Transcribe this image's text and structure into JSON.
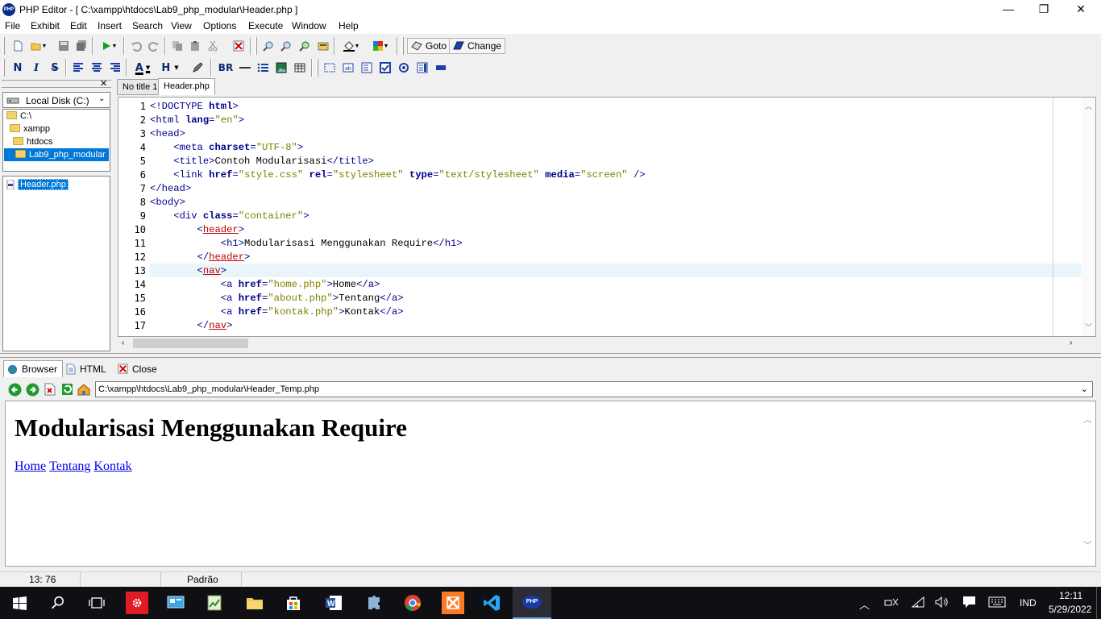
{
  "window": {
    "app_icon": "PHP",
    "title": "PHP Editor - [ C:\\xampp\\htdocs\\Lab9_php_modular\\Header.php ]",
    "minimize": "—",
    "maximize": "❐",
    "close": "✕"
  },
  "menu": [
    "File",
    "Exhibit",
    "Edit",
    "Insert",
    "Search",
    "View",
    "Options",
    "Execute",
    "Window",
    "Help"
  ],
  "toolbar1": {
    "goto_label": "Goto",
    "change_label": "Change"
  },
  "toolbar2": {
    "bold": "N",
    "italic": "I",
    "strike": "S",
    "font_color": "A",
    "heading": "H",
    "br": "BR"
  },
  "file_panel": {
    "drive": "Local Disk (C:)",
    "folders": [
      "C:\\",
      "xampp",
      "htdocs",
      "Lab9_php_modular"
    ],
    "files": [
      "Header.php"
    ]
  },
  "editor": {
    "tabs": [
      "No title 1",
      "Header.php"
    ],
    "active_tab": "Header.php",
    "lines": [
      {
        "n": "1",
        "code": "<!DOCTYPE html>"
      },
      {
        "n": "2",
        "code": "<html lang=\"en\">"
      },
      {
        "n": "3",
        "code": "<head>"
      },
      {
        "n": "4",
        "code": "    <meta charset=\"UTF-8\">"
      },
      {
        "n": "5",
        "code": "    <title>Contoh Modularisasi</title>"
      },
      {
        "n": "6",
        "code": "    <link href=\"style.css\" rel=\"stylesheet\" type=\"text/stylesheet\" media=\"screen\" />"
      },
      {
        "n": "7",
        "code": "</head>"
      },
      {
        "n": "8",
        "code": "<body>"
      },
      {
        "n": "9",
        "code": "    <div class=\"container\">"
      },
      {
        "n": "10",
        "code": "        <header>"
      },
      {
        "n": "11",
        "code": "            <h1>Modularisasi Menggunakan Require</h1>"
      },
      {
        "n": "12",
        "code": "        </header>"
      },
      {
        "n": "13",
        "code": "        <nav>"
      },
      {
        "n": "14",
        "code": "            <a href=\"home.php\">Home</a>"
      },
      {
        "n": "15",
        "code": "            <a href=\"about.php\">Tentang</a>"
      },
      {
        "n": "16",
        "code": "            <a href=\"kontak.php\">Kontak</a>"
      },
      {
        "n": "17",
        "code": "        </nav>"
      }
    ]
  },
  "bottom_panel": {
    "tabs": [
      "Browser",
      "HTML",
      "Close"
    ],
    "address": "C:\\xampp\\htdocs\\Lab9_php_modular\\Header_Temp.php",
    "page_heading": "Modularisasi Menggunakan Require",
    "page_links": [
      "Home",
      "Tentang",
      "Kontak"
    ]
  },
  "status": {
    "position": "13:  76",
    "encoding": "Padrão"
  },
  "taskbar": {
    "language": "IND",
    "time": "12:11",
    "date": "5/29/2022"
  },
  "colors": {
    "tag": "#00008b",
    "value": "#808000",
    "semantic_tag": "#c00000",
    "selection": "#0078d7",
    "taskbar": "#101014"
  }
}
